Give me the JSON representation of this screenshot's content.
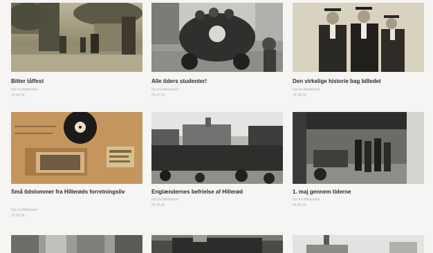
{
  "cards": [
    {
      "title": "Bitter tåffest",
      "source": "Nyt fra Biblioteket",
      "date": "25.09.24"
    },
    {
      "title": "Alle tiders studenter!",
      "source": "Nyt fra Biblioteket",
      "date": "25.07.20"
    },
    {
      "title": "Den virkelige historie bag billedet",
      "source": "Nyt fra Biblioteket",
      "date": "14.08.18"
    },
    {
      "title": "Små tidslommer fra Hillerøds forretningsliv",
      "source": "Nyt fra Biblioteket",
      "date": "22.05.24"
    },
    {
      "title": "Englændernes befrielse af Hillerød",
      "source": "Nyt fra Biblioteket",
      "date": "04.05.20"
    },
    {
      "title": "1. maj gennem tiderne",
      "source": "Nyt fra Biblioteket",
      "date": "04.05.20"
    }
  ]
}
